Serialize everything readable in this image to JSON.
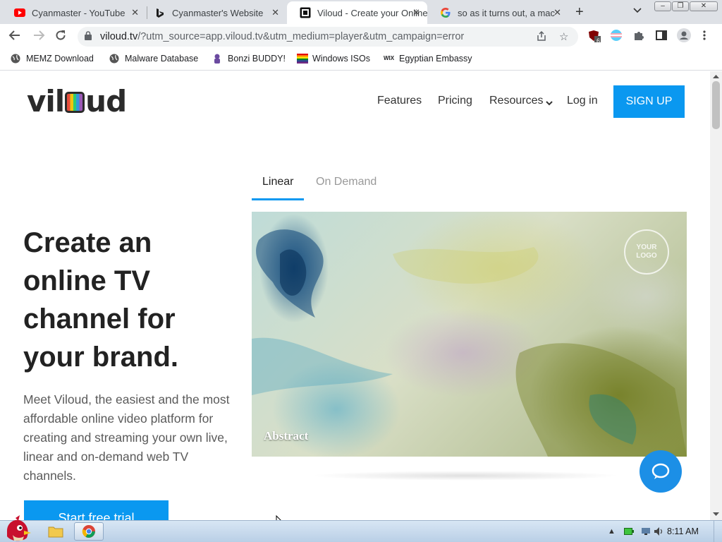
{
  "browser": {
    "tabs": [
      {
        "title": "Cyanmaster - YouTube",
        "close": "✕"
      },
      {
        "title": "Cyanmaster's Website",
        "close": "✕"
      },
      {
        "title": "Viloud - Create your Online TV Channel",
        "close": "✕"
      },
      {
        "title": "so as it turns out, a mac",
        "close": "✕"
      }
    ],
    "new_tab": "+",
    "address_bar": {
      "host": "viloud.tv",
      "path": "/?utm_source=app.viloud.tv&utm_medium=player&utm_campaign=error"
    },
    "extension_badge": "6",
    "bookmarks": [
      {
        "label": "MEMZ Download"
      },
      {
        "label": "Malware Database"
      },
      {
        "label": "Bonzi BUDDY!"
      },
      {
        "label": "Windows ISOs"
      },
      {
        "label": "Egyptian Embassy"
      }
    ]
  },
  "site": {
    "logo_text": "viloud",
    "nav": {
      "features": "Features",
      "pricing": "Pricing",
      "resources": "Resources",
      "login": "Log in",
      "signup": "SIGN UP"
    },
    "hero": {
      "headline": "Create an online TV channel for your brand.",
      "description": "Meet Viloud, the easiest and the most affordable online video platform for creating and streaming your own live, linear and on-demand web TV channels.",
      "cta": "Start free trial"
    },
    "player_tabs": {
      "linear": "Linear",
      "on_demand": "On Demand"
    },
    "video": {
      "channel_label": "Abstract",
      "watermark": "YOUR LOGO"
    }
  },
  "taskbar": {
    "clock": "8:11 AM"
  },
  "colors": {
    "accent": "#0a98f0",
    "chat_bubble": "#1c8fe6"
  }
}
